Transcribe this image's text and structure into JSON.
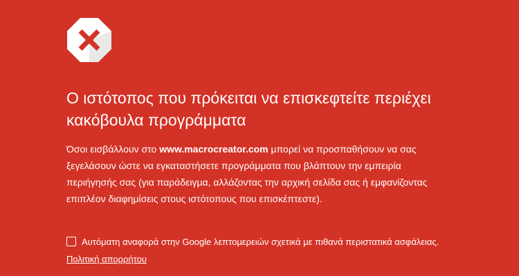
{
  "icon": {
    "name": "red-x-octagon-icon",
    "x_color": "#d33226",
    "background": "#ffffff"
  },
  "page": {
    "background_color": "#d33226",
    "text_color": "#ffffff"
  },
  "headline": {
    "line1": "Ο ιστότοπος που πρόκειται να επισκεφτείτε περιέχει",
    "line2": "κακόβουλα προγράμματα"
  },
  "explanation": {
    "line1_before": "Όσοι εισβάλλουν στο ",
    "site": "www.macrocreator.com",
    "line1_after": " μπορεί να προσπαθήσουν να σας",
    "line2": "ξεγελάσουν ώστε να εγκαταστήσετε προγράμματα που βλάπτουν την εμπειρία",
    "line3": "περιήγησής σας (για παράδειγμα, αλλάζοντας την αρχική σελίδα σας ή εμφανίζοντας",
    "line4": "επιπλέον διαφημίσεις στους ιστότοπους που επισκέπτεστε)."
  },
  "report": {
    "checked": false,
    "label": "Αυτόματη αναφορά στην Google λεπτομερειών σχετικά με πιθανά περιστατικά ασφάλειας."
  },
  "privacy_link": {
    "label": "Πολιτική απορρήτου"
  }
}
